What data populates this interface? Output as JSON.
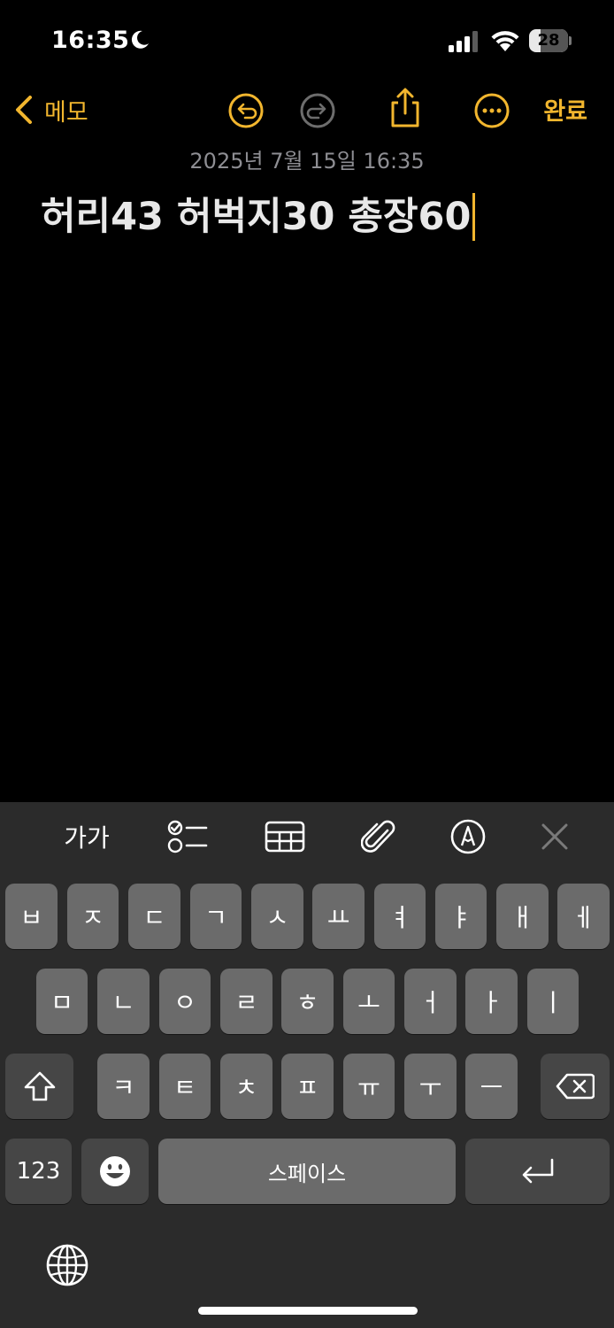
{
  "status": {
    "time": "16:35",
    "battery": "28"
  },
  "nav": {
    "back_label": "메모",
    "done_label": "완료"
  },
  "note": {
    "date": "2025년 7월 15일 16:35",
    "text": "허리43 허벅지30 총장60"
  },
  "keyboard_toolbar": {
    "format_label": "가가"
  },
  "keyboard": {
    "row1": [
      "ㅂ",
      "ㅈ",
      "ㄷ",
      "ㄱ",
      "ㅅ",
      "ㅛ",
      "ㅕ",
      "ㅑ",
      "ㅐ",
      "ㅔ"
    ],
    "row2": [
      "ㅁ",
      "ㄴ",
      "ㅇ",
      "ㄹ",
      "ㅎ",
      "ㅗ",
      "ㅓ",
      "ㅏ",
      "ㅣ"
    ],
    "row3": [
      "ㅋ",
      "ㅌ",
      "ㅊ",
      "ㅍ",
      "ㅠ",
      "ㅜ",
      "ㅡ"
    ],
    "numbers_label": "123",
    "space_label": "스페이스"
  },
  "colors": {
    "accent": "#f2b62e",
    "background": "#000000",
    "keyboard_bg": "#2b2b2b",
    "key_bg": "#6b6b6b",
    "key_dark_bg": "#464646"
  }
}
